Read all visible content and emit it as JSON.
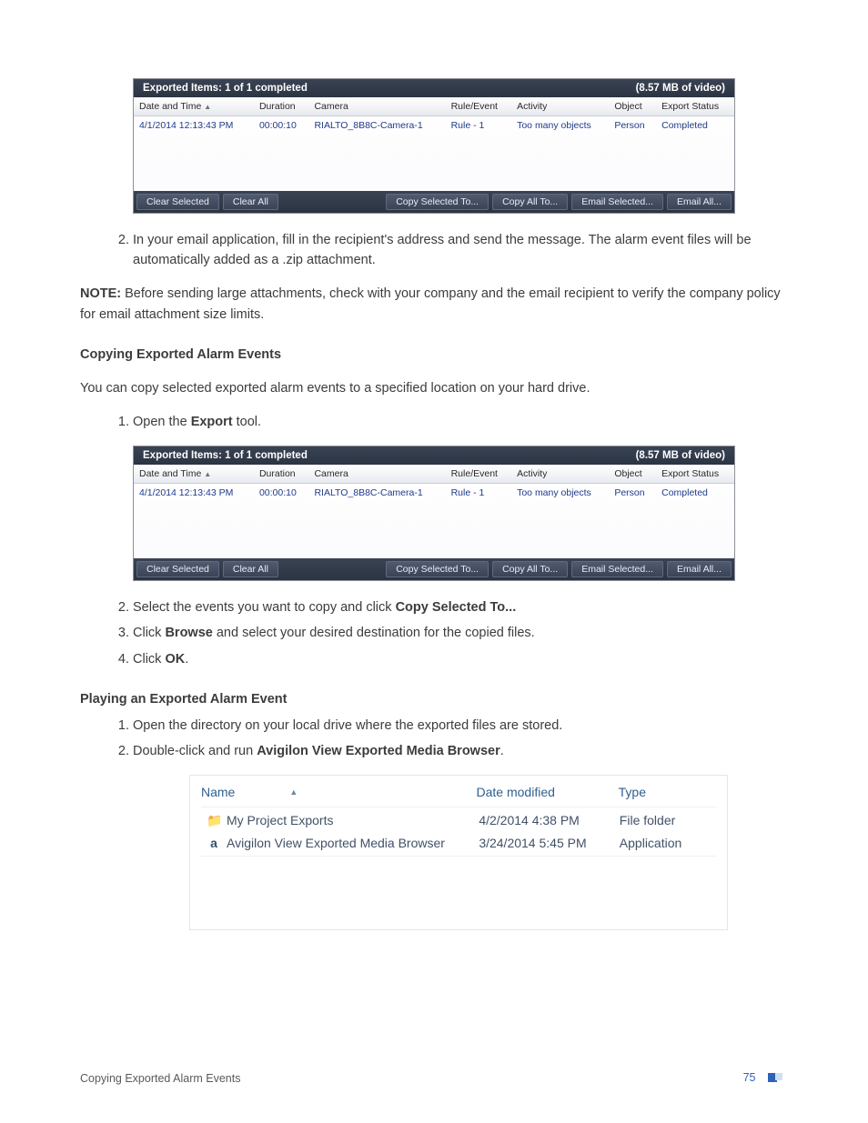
{
  "panel": {
    "title_left": "Exported Items:  1 of 1 completed",
    "title_right": "(8.57 MB of video)",
    "columns": {
      "datetime": "Date and Time",
      "duration": "Duration",
      "camera": "Camera",
      "ruleevent": "Rule/Event",
      "activity": "Activity",
      "object": "Object",
      "exportstatus": "Export Status"
    },
    "row": {
      "datetime": "4/1/2014 12:13:43 PM",
      "duration": "00:00:10",
      "camera": "RIALTO_8B8C-Camera-1",
      "ruleevent": "Rule - 1",
      "activity": "Too many objects",
      "object": "Person",
      "exportstatus": "Completed"
    },
    "buttons": {
      "clear_selected": "Clear Selected",
      "clear_all": "Clear All",
      "copy_selected_to": "Copy Selected To...",
      "copy_all_to": "Copy All To...",
      "email_selected": "Email Selected...",
      "email_all": "Email All..."
    }
  },
  "body": {
    "step2_top": "In your email application, fill in the recipient's address and send the message. The alarm event files will be automatically added as a .zip attachment.",
    "note_label": "NOTE: ",
    "note_text": "Before sending large attachments, check with your company and the email recipient to verify the company policy for email attachment size limits.",
    "heading_copying": "Copying Exported Alarm Events",
    "copy_intro": "You can copy selected exported alarm events to a specified location on your hard drive.",
    "open_export_pre": "Open the ",
    "open_export_b": "Export",
    "open_export_post": " tool.",
    "copy_step2_pre": "Select the events you want to copy and click ",
    "copy_step2_b": "Copy Selected To...",
    "copy_step3_pre": "Click ",
    "copy_step3_b": "Browse",
    "copy_step3_post": " and select your desired destination for the copied files.",
    "copy_step4_pre": "Click ",
    "copy_step4_b": "OK",
    "copy_step4_post": ".",
    "heading_playing": "Playing an Exported Alarm Event",
    "play_step1": "Open the directory on your local drive where the exported files are stored.",
    "play_step2_pre": "Double-click and run ",
    "play_step2_b": "Avigilon View Exported Media Browser",
    "play_step2_post": "."
  },
  "explorer": {
    "headers": {
      "name": "Name",
      "date": "Date modified",
      "type": "Type"
    },
    "rows": [
      {
        "icon": "folder",
        "name": "My Project Exports",
        "date": "4/2/2014 4:38 PM",
        "type": "File folder"
      },
      {
        "icon": "app",
        "name": "Avigilon View Exported Media Browser",
        "date": "3/24/2014 5:45 PM",
        "type": "Application"
      }
    ]
  },
  "footer": {
    "left": "Copying Exported Alarm Events",
    "page": "75"
  }
}
